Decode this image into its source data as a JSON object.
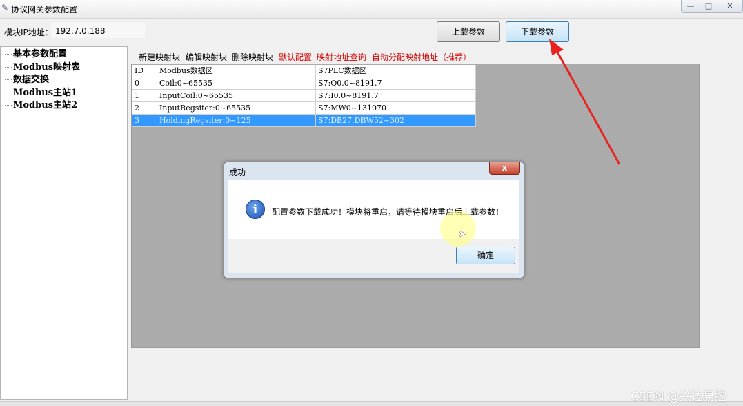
{
  "window": {
    "title": "协议网关参数配置",
    "controls": {
      "minimize": "—",
      "maximize": "□",
      "close": "✕"
    }
  },
  "top": {
    "ip_label": "模块IP地址：",
    "ip_value": "192.7.0.188",
    "upload_button": "上载参数",
    "download_button": "下载参数"
  },
  "tree": {
    "items": [
      "基本参数配置",
      "Modbus映射表",
      "数据交换",
      "Modbus主站1",
      "Modbus主站2"
    ]
  },
  "toolbar": {
    "items": [
      "新建映射块",
      "编辑映射块",
      "删除映射块"
    ],
    "red_items": [
      "默认配置",
      "映射地址查询",
      "自动分配映射地址（推荐）"
    ]
  },
  "table": {
    "headers": [
      "ID",
      "Modbus数据区",
      "S7PLC数据区"
    ],
    "rows": [
      [
        "0",
        "Coil:0~65535",
        "S7:Q0.0~8191.7"
      ],
      [
        "1",
        "InputCoil:0~65535",
        "S7:I0.0~8191.7"
      ],
      [
        "2",
        "InputRegsiter:0~65535",
        "S7:MW0~131070"
      ],
      [
        "3",
        "HoldingRegsiter:0~125",
        "S7:DB27.DBW52~302"
      ]
    ],
    "selected_row": 3
  },
  "dialog": {
    "title": "成功",
    "close_glyph": "x",
    "icon": "info-icon",
    "icon_glyph": "i",
    "message": "配置参数下载成功！模块将重启，请等待模块重启后上载参数！",
    "ok_button": "确定"
  },
  "annotation": {
    "arrow_color": "#e8231f"
  },
  "watermark": "CSDN @兴达易控"
}
